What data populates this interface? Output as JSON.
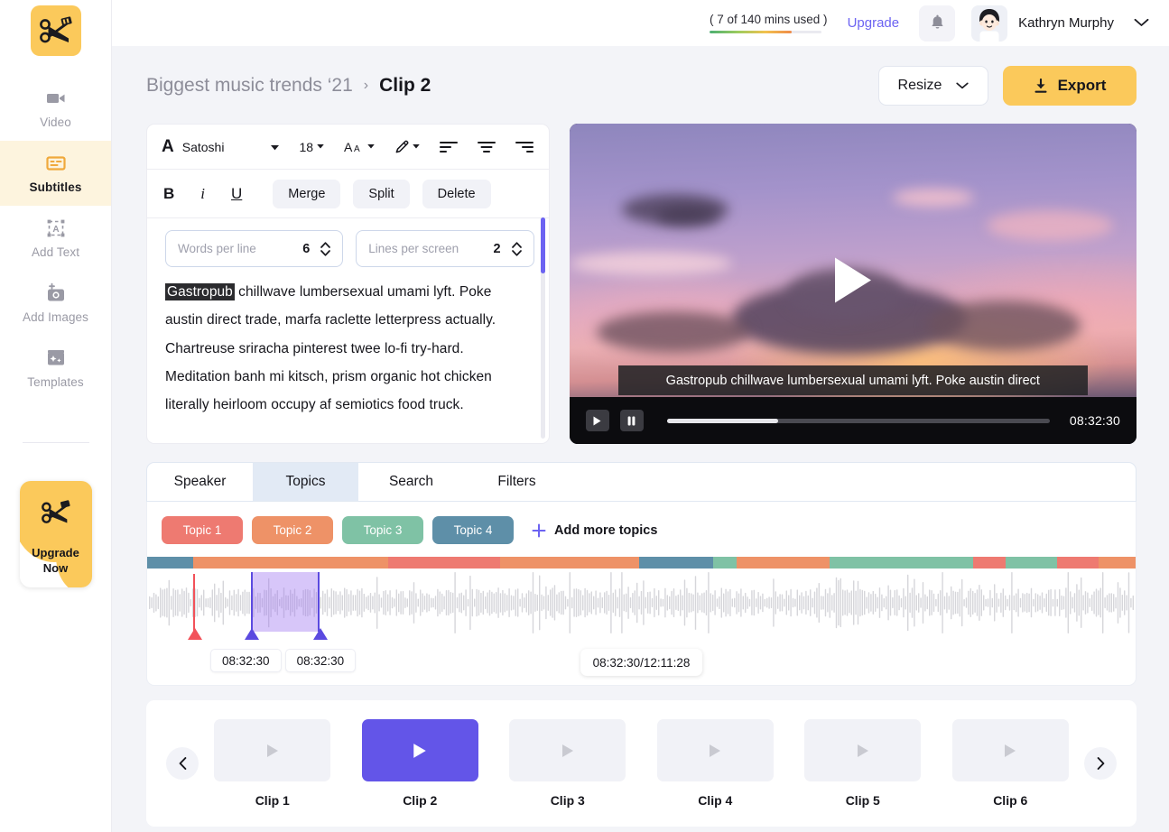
{
  "sidebar": {
    "logo_icon": "clapper-scissors-logo",
    "items": [
      {
        "label": "Video",
        "icon": "video-camera-icon",
        "active": false
      },
      {
        "label": "Subtitles",
        "icon": "subtitles-icon",
        "active": true
      },
      {
        "label": "Add Text",
        "icon": "add-text-icon",
        "active": false
      },
      {
        "label": "Add Images",
        "icon": "add-image-icon",
        "active": false
      },
      {
        "label": "Templates",
        "icon": "templates-icon",
        "active": false
      }
    ],
    "upgrade_card": {
      "line1": "Upgrade",
      "line2": "Now"
    }
  },
  "topbar": {
    "mins_used_text": "( 7 of 140 mins used )",
    "mins_used_percent": 73,
    "upgrade_label": "Upgrade",
    "bell_icon": "bell-icon",
    "user_name": "Kathryn Murphy",
    "chevron_icon": "chevron-down-icon"
  },
  "header": {
    "breadcrumb_parent": "Biggest music trends ‘21",
    "breadcrumb_sep": "›",
    "breadcrumb_current": "Clip 2",
    "resize_label": "Resize",
    "export_label": "Export",
    "export_icon": "download-icon"
  },
  "editor": {
    "toolbar": {
      "font_icon": "font-letter-a-icon",
      "font_name": "Satoshi",
      "font_size": "18",
      "case_icon": "text-case-icon",
      "color_icon": "pen-color-icon",
      "align_left_icon": "align-left-icon",
      "align_center_icon": "align-center-icon",
      "align_right_icon": "align-right-icon",
      "bold_label": "B",
      "italic_label": "i",
      "underline_label": "U",
      "merge_label": "Merge",
      "split_label": "Split",
      "delete_label": "Delete"
    },
    "words_per_line": {
      "label": "Words per line",
      "value": "6"
    },
    "lines_per_screen": {
      "label": "Lines per screen",
      "value": "2"
    },
    "subtitle_highlight": "Gastropub",
    "subtitle_rest": " chillwave lumbersexual umami lyft. Poke austin direct trade, marfa raclette letterpress actually. Chartreuse sriracha pinterest twee lo-fi try-hard. Meditation banh mi kitsch, prism organic hot chicken literally heirloom occupy af semiotics food truck."
  },
  "video": {
    "caption": "Gastropub chillwave lumbersexual umami lyft. Poke austin direct",
    "play_icon": "play-icon",
    "pause_icon": "pause-icon",
    "timestamp": "08:32:30",
    "progress_percent": 29
  },
  "tabs": [
    {
      "label": "Speaker",
      "active": false
    },
    {
      "label": "Topics",
      "active": true
    },
    {
      "label": "Search",
      "active": false
    },
    {
      "label": "Filters",
      "active": false
    }
  ],
  "topics": {
    "pills": [
      {
        "label": "Topic 1",
        "color": "#ee7a71"
      },
      {
        "label": "Topic 2",
        "color": "#ee9267"
      },
      {
        "label": "Topic 3",
        "color": "#7fc2a5"
      },
      {
        "label": "Topic 4",
        "color": "#5e8fa8"
      }
    ],
    "add_more_label": "Add more topics",
    "add_icon": "plus-icon",
    "strip_segments": [
      {
        "color": "#5e8fa8",
        "width": 5
      },
      {
        "color": "#ee9267",
        "width": 21
      },
      {
        "color": "#ee7a71",
        "width": 12
      },
      {
        "color": "#ee9267",
        "width": 15
      },
      {
        "color": "#5e8fa8",
        "width": 8
      },
      {
        "color": "#7fc2a5",
        "width": 2.5
      },
      {
        "color": "#ee9267",
        "width": 10
      },
      {
        "color": "#7fc2a5",
        "width": 15.5
      },
      {
        "color": "#ee7a71",
        "width": 3.5
      },
      {
        "color": "#7fc2a5",
        "width": 5.5
      },
      {
        "color": "#ee7a71",
        "width": 4.5
      },
      {
        "color": "#ee9267",
        "width": 4
      }
    ],
    "timeline": {
      "playhead_color": "#f2525a",
      "selection_color": "#5b4ae0",
      "chip_start": "08:32:30",
      "chip_end": "08:32:30",
      "center_chip": "08:32:30/12:11:28"
    }
  },
  "clips": {
    "prev_icon": "chevron-left-icon",
    "next_icon": "chevron-right-icon",
    "items": [
      {
        "label": "Clip 1",
        "active": false
      },
      {
        "label": "Clip 2",
        "active": true
      },
      {
        "label": "Clip 3",
        "active": false
      },
      {
        "label": "Clip 4",
        "active": false
      },
      {
        "label": "Clip 5",
        "active": false
      },
      {
        "label": "Clip 6",
        "active": false
      }
    ]
  }
}
